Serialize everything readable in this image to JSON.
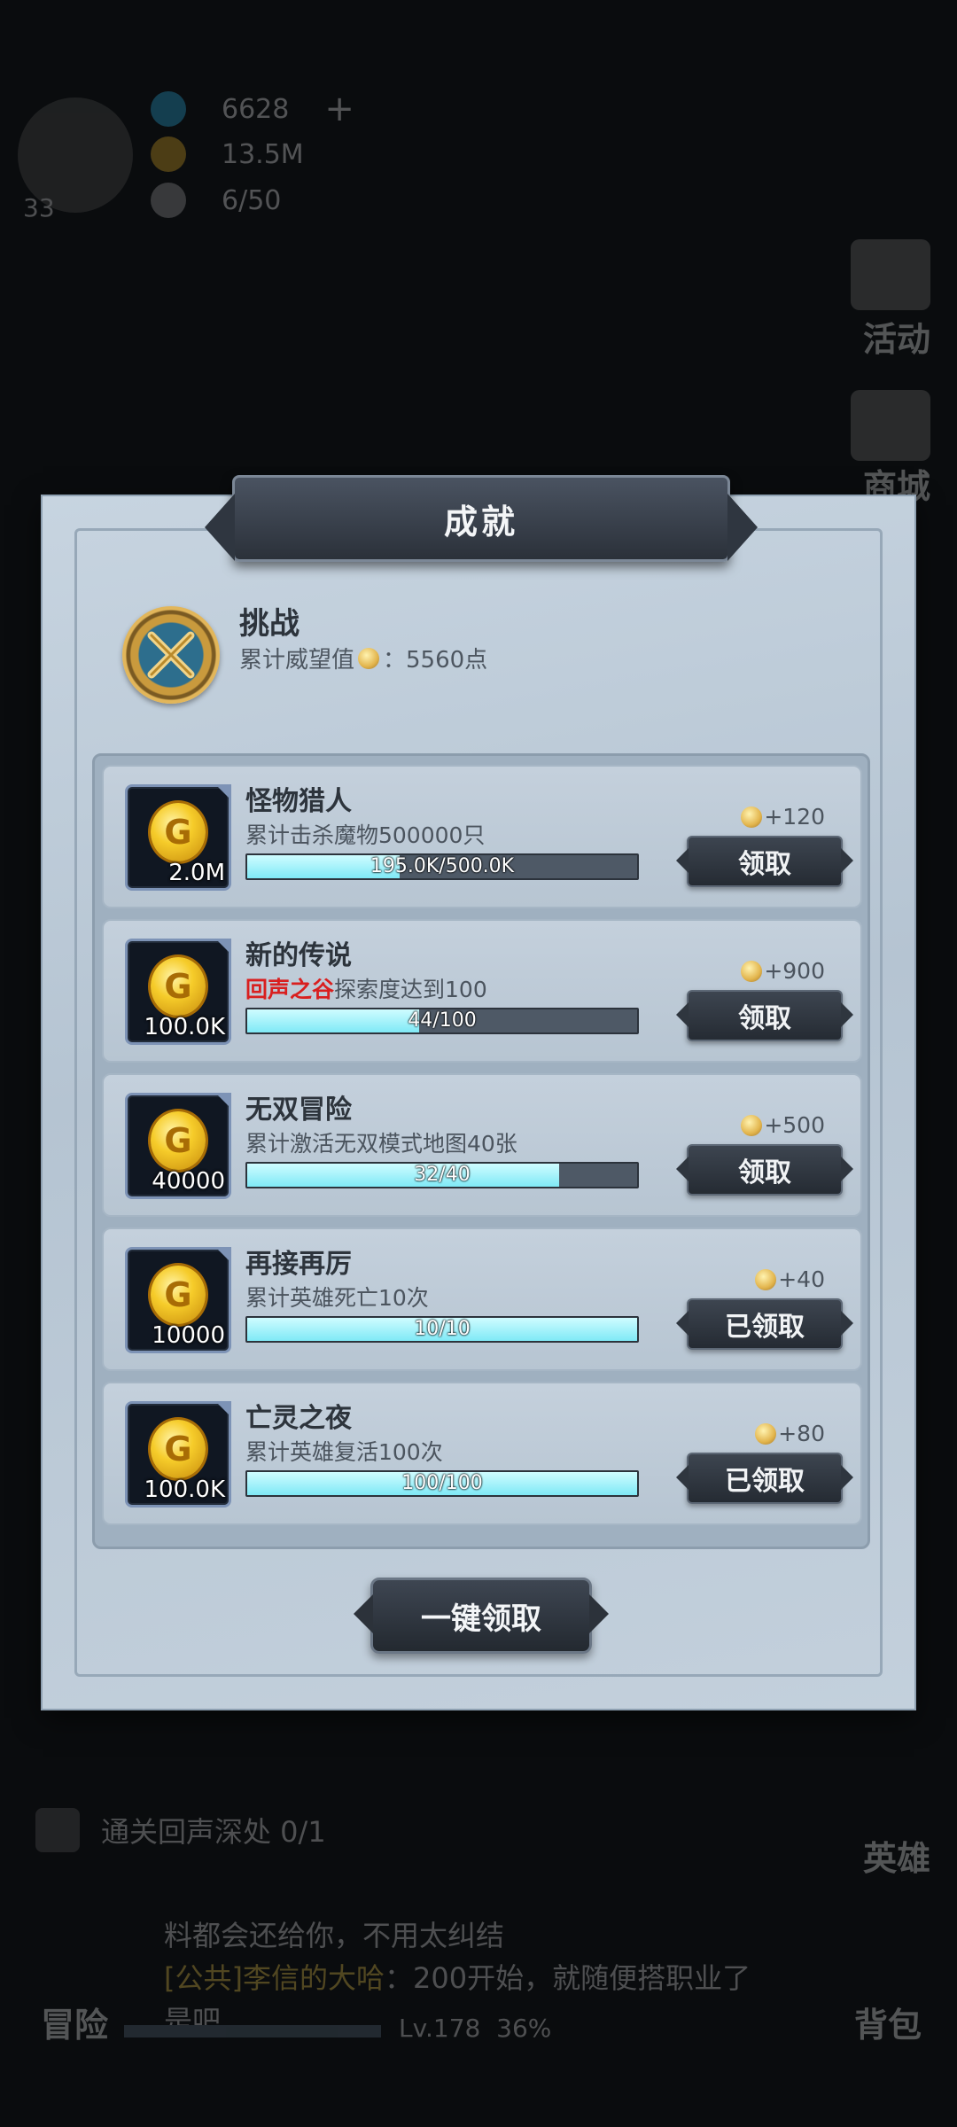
{
  "hud": {
    "diamonds": "6628",
    "gold": "13.5M",
    "stamina": "6/50",
    "level": "33"
  },
  "side_menu": {
    "activity": "活动",
    "shop": "商城",
    "hero": "英雄",
    "bag": "背包"
  },
  "bottom": {
    "quest": "通关回声深处 0/1",
    "dialog_line1": "料都会还给你，不用太纠结",
    "dialog_line2_highlight": "[公共]李信的大哈",
    "dialog_line2_rest": "：200开始，就随便搭职业了",
    "dialog_line3": "是吧",
    "adventure": "冒险",
    "player_level": "Lv.178",
    "player_progress": "36%"
  },
  "panel": {
    "title": "成就",
    "category": {
      "name": "挑战",
      "reputation_label": "累计威望值",
      "reputation_value": "：5560点"
    },
    "claim_all": "一键领取"
  },
  "achievements": [
    {
      "title": "怪物猎人",
      "desc_highlight": "",
      "desc": "累计击杀魔物500000只",
      "progress_text": "195.0K/500.0K",
      "progress": 0.39,
      "reward": "+120",
      "reward_amount": "2.0M",
      "button": "领取"
    },
    {
      "title": "新的传说",
      "desc_highlight": "回声之谷",
      "desc": "探索度达到100",
      "progress_text": "44/100",
      "progress": 0.44,
      "reward": "+900",
      "reward_amount": "100.0K",
      "button": "领取"
    },
    {
      "title": "无双冒险",
      "desc_highlight": "",
      "desc": "累计激活无双模式地图40张",
      "progress_text": "32/40",
      "progress": 0.8,
      "reward": "+500",
      "reward_amount": "40000",
      "button": "领取"
    },
    {
      "title": "再接再厉",
      "desc_highlight": "",
      "desc": "累计英雄死亡10次",
      "progress_text": "10/10",
      "progress": 1.0,
      "reward": "+40",
      "reward_amount": "10000",
      "button": "已领取"
    },
    {
      "title": "亡灵之夜",
      "desc_highlight": "",
      "desc": "累计英雄复活100次",
      "progress_text": "100/100",
      "progress": 1.0,
      "reward": "+80",
      "reward_amount": "100.0K",
      "button": "已领取"
    }
  ],
  "icons": {
    "coin": "gold-coin-icon",
    "reputation": "reputation-medal-icon",
    "category": "crossed-swords-icon"
  },
  "colors": {
    "highlight_red": "#d91f1f",
    "bar_fill": "#7fe9f6",
    "panel_bg": "#bccad7"
  }
}
